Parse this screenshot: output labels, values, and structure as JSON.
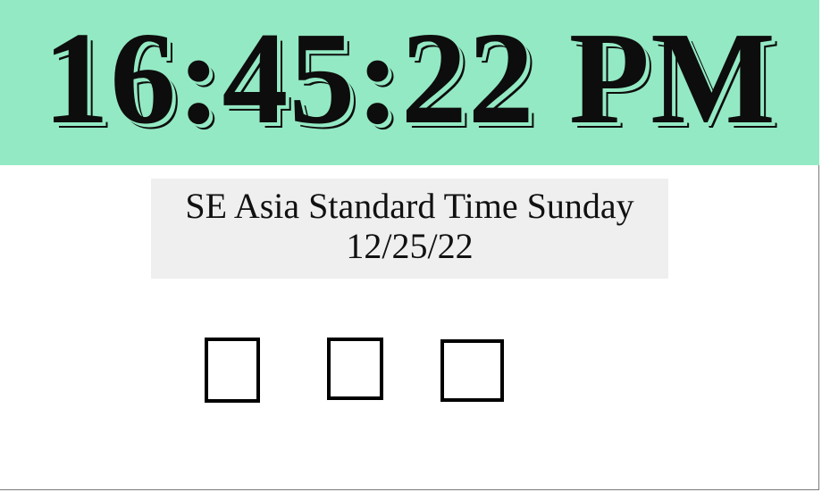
{
  "clock": {
    "time": "16:45:22 PM",
    "background_color": "#93e9c3"
  },
  "info": {
    "timezone_day": "SE Asia Standard Time Sunday",
    "date": "12/25/22",
    "background_color": "#efefef"
  },
  "glyphs": [
    {
      "icon": "missing-glyph-box-icon"
    },
    {
      "icon": "missing-glyph-box-icon"
    },
    {
      "icon": "missing-glyph-box-icon"
    }
  ]
}
